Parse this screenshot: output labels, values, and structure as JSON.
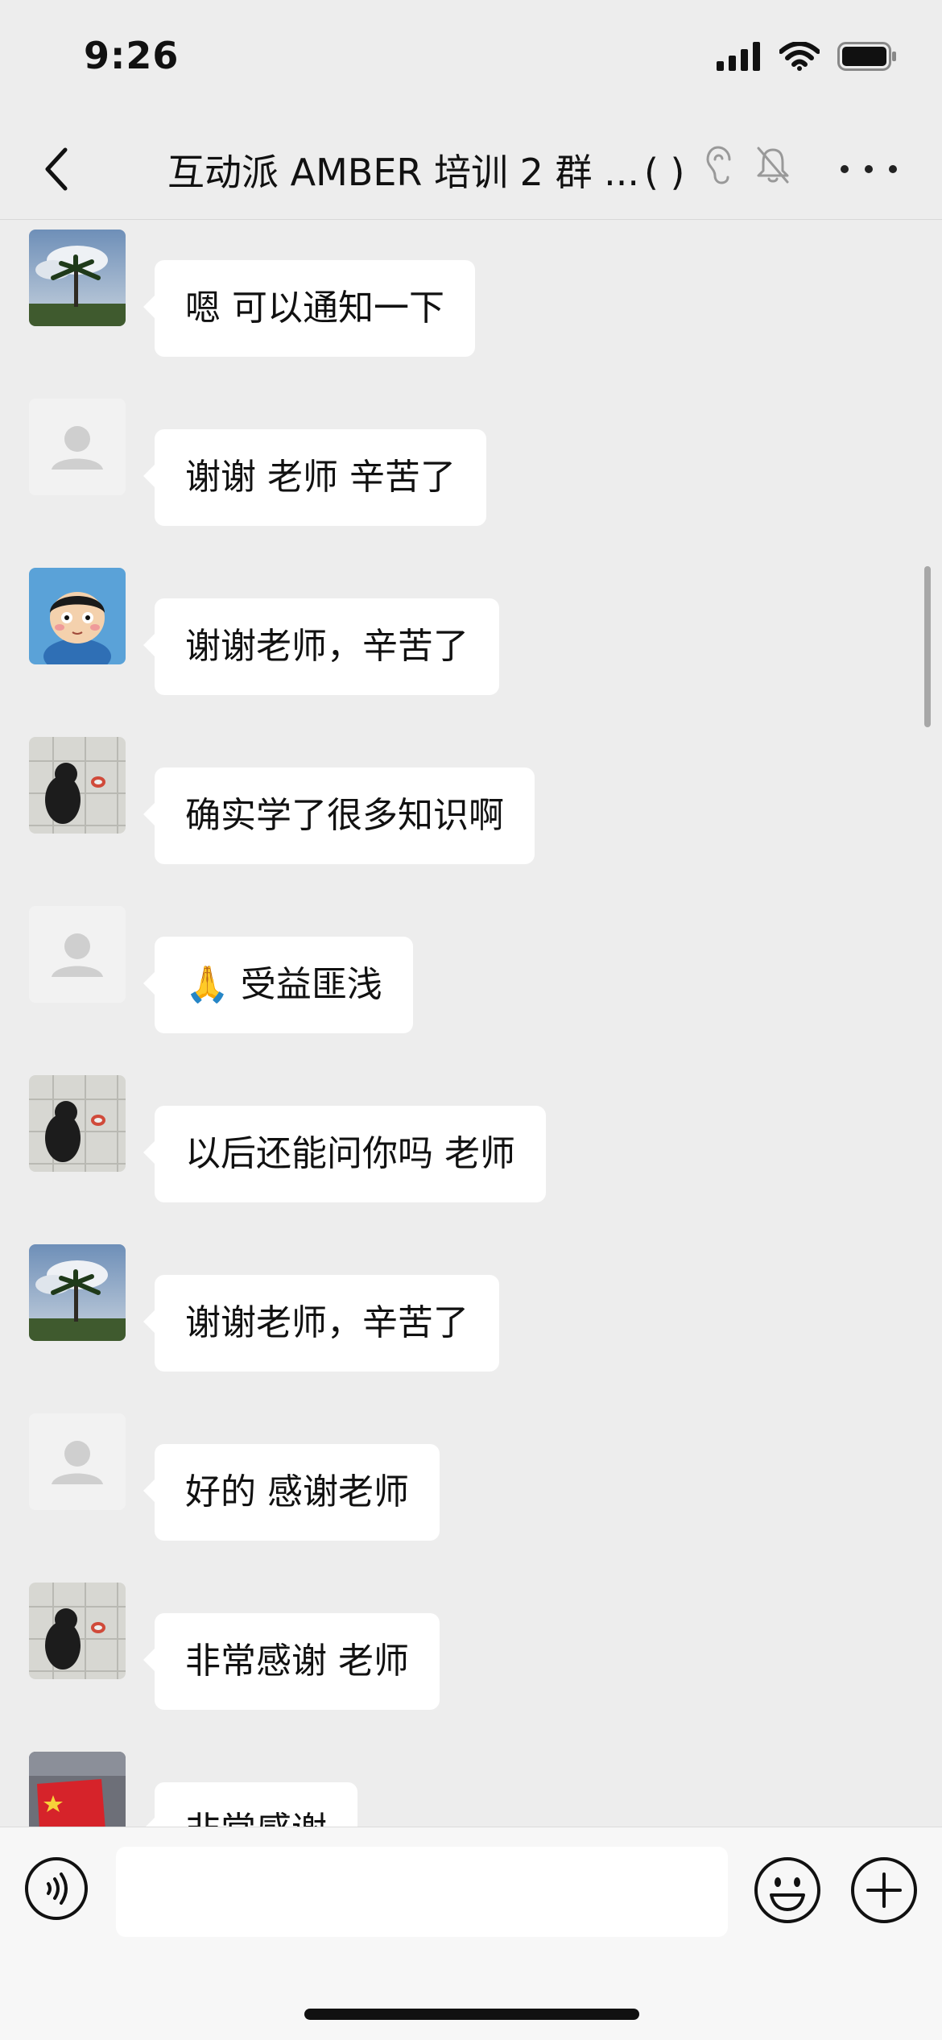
{
  "status_bar": {
    "time": "9:26"
  },
  "header": {
    "title": "互动派 AMBER 培训 2 群 ...",
    "title_suffix": "(    )"
  },
  "messages": [
    {
      "text": "嗯 可以通知一下",
      "avatar": "avatar-palm-tree"
    },
    {
      "text": "谢谢 老师 辛苦了",
      "avatar": "avatar-default"
    },
    {
      "text": "谢谢老师，辛苦了",
      "avatar": "avatar-cartoon-boy"
    },
    {
      "text": "确实学了很多知识啊",
      "avatar": "avatar-penguin"
    },
    {
      "text": "🙏 受益匪浅",
      "avatar": "avatar-default"
    },
    {
      "text": "以后还能问你吗 老师",
      "avatar": "avatar-penguin"
    },
    {
      "text": "谢谢老师，辛苦了",
      "avatar": "avatar-palm-tree"
    },
    {
      "text": "好的 感谢老师",
      "avatar": "avatar-default"
    },
    {
      "text": "非常感谢 老师",
      "avatar": "avatar-penguin"
    },
    {
      "text": "非常感谢",
      "avatar": "avatar-flag"
    }
  ],
  "input": {
    "value": ""
  },
  "icons": {
    "back": "chevron-left-icon",
    "ear": "ear-icon",
    "mute": "bell-slash-icon",
    "more": "more-dots-icon",
    "voice": "voice-icon",
    "emoji": "emoji-icon",
    "plus": "plus-icon"
  },
  "colors": {
    "background": "#ededed",
    "bubble": "#ffffff",
    "input_bar": "#f7f7f7"
  }
}
